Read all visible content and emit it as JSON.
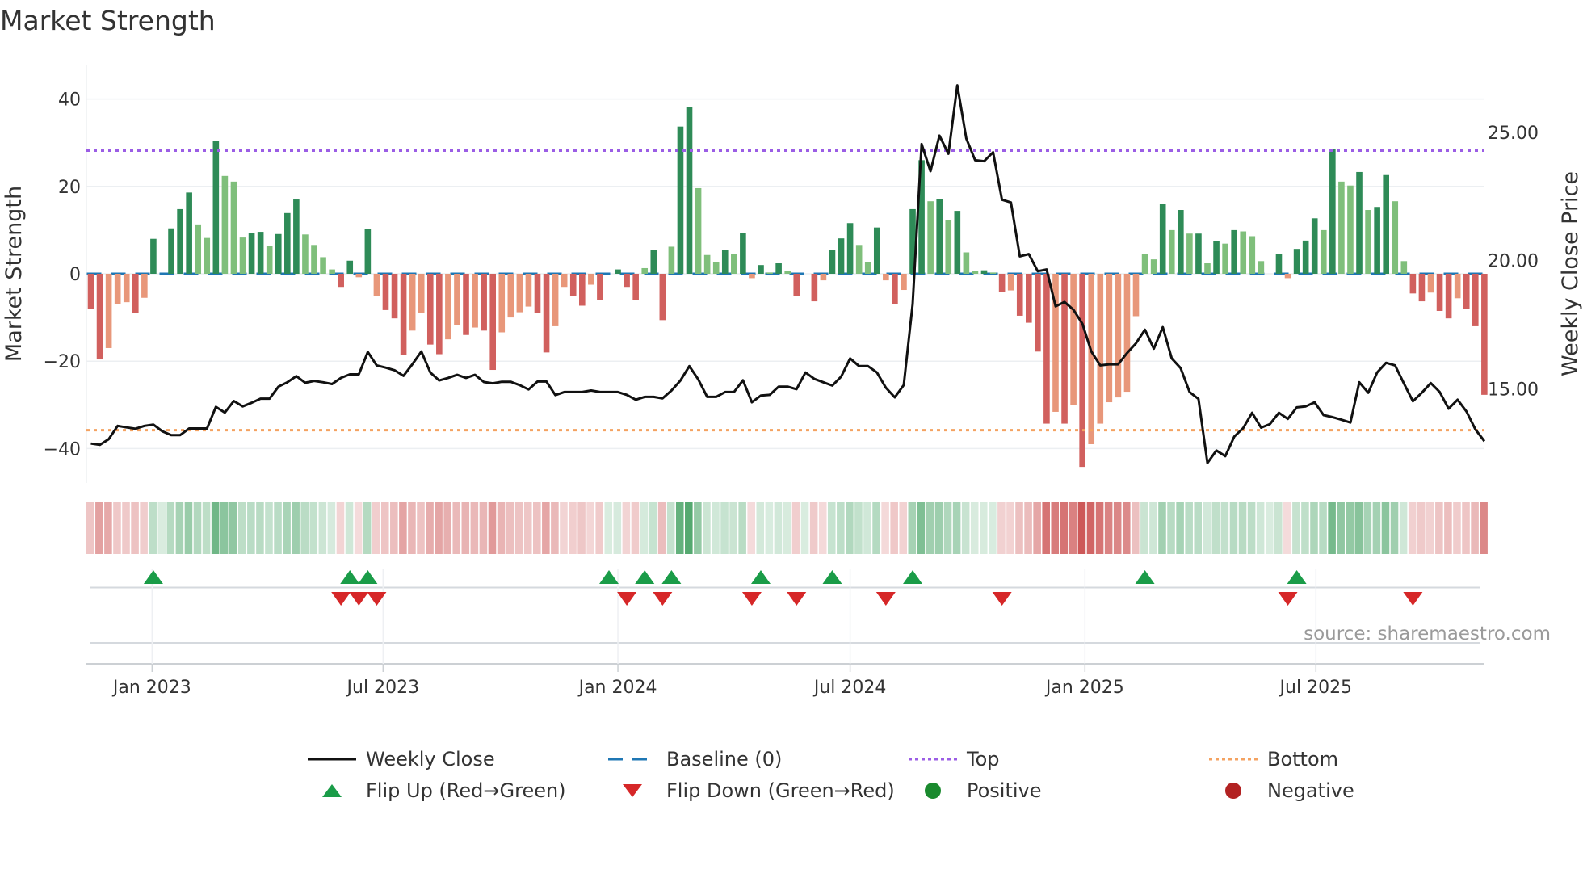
{
  "title": "Market Strength",
  "source": "source: sharemaestro.com",
  "colors": {
    "pos_strong": "#2e8b57",
    "pos_weak": "#7fbf7b",
    "neg_strong": "#d1605e",
    "neg_weak": "#e8977a",
    "line": "#111111",
    "baseline": "#1f77b4",
    "top": "#9b5de5",
    "bottom": "#f4a261",
    "flip_up": "#1a9c48",
    "flip_down": "#d62728",
    "positive": "#1a8a2e",
    "negative": "#b22222"
  },
  "legend": {
    "weekly_close": "Weekly Close",
    "baseline": "Baseline (0)",
    "top": "Top",
    "bottom": "Bottom",
    "flip_up": "Flip Up (Red→Green)",
    "flip_down": "Flip Down (Green→Red)",
    "positive": "Positive",
    "negative": "Negative"
  },
  "chart_data": {
    "type": "bar",
    "title": "Market Strength",
    "ylabel": "Market Strength",
    "y2label": "Weekly Close Price",
    "ylim": [
      -48,
      48
    ],
    "y2lim": [
      11.8,
      27.3
    ],
    "yticks": [
      "40",
      "20",
      "0",
      "−20",
      "−40"
    ],
    "ytick_values": [
      40,
      20,
      0,
      -20,
      -40
    ],
    "y2ticks": [
      "25.00",
      "20.00",
      "15.00"
    ],
    "y2tick_values": [
      25,
      20,
      15
    ],
    "xticks": [
      {
        "label": "Jan 2023",
        "date": "2023-01-01"
      },
      {
        "label": "Jul 2023",
        "date": "2023-07-01"
      },
      {
        "label": "Jan 2024",
        "date": "2024-01-01"
      },
      {
        "label": "Jul 2024",
        "date": "2024-07-01"
      },
      {
        "label": "Jan 2025",
        "date": "2025-01-01"
      },
      {
        "label": "Jul 2025",
        "date": "2025-07-01"
      }
    ],
    "first_week": "2022-11-14",
    "top_level": 28.2,
    "bottom_level": -35.8,
    "strength": [
      -8,
      -19.6,
      -17,
      -7,
      -6.5,
      -9,
      -5.5,
      8,
      0,
      10.4,
      14.8,
      18.6,
      11.3,
      8.2,
      30.4,
      22.4,
      21.1,
      8.3,
      9.3,
      9.6,
      6.4,
      9.1,
      13.9,
      17,
      9,
      6.6,
      3.8,
      1,
      -3,
      3,
      -0.8,
      10.3,
      -5,
      -8.3,
      -10.2,
      -18.6,
      -13,
      -8.9,
      -16.2,
      -18.4,
      -15,
      -11.8,
      -14,
      -12.3,
      -13,
      -22,
      -13.4,
      -10,
      -8.8,
      -7.5,
      -9,
      -18,
      -12,
      -3,
      -5,
      -7.3,
      -2.5,
      -6,
      0,
      1,
      -3,
      -6,
      1.3,
      5.5,
      -10.6,
      6.2,
      33.7,
      38.2,
      19.6,
      4.3,
      2.6,
      5.5,
      4.6,
      9.4,
      -1,
      2,
      0.3,
      2.4,
      0.7,
      -5,
      0,
      -6.3,
      -1.5,
      5.4,
      8.1,
      11.6,
      6.6,
      2.6,
      10.6,
      -1.5,
      -7,
      -3.7,
      14.8,
      26,
      16.6,
      17.1,
      12.3,
      14.4,
      4.9,
      0.6,
      0.8,
      0.3,
      -4.2,
      -3.8,
      -9.6,
      -11.2,
      -17.8,
      -34.3,
      -31.6,
      -34.3,
      -30,
      -44.2,
      -39,
      -34.3,
      -29.4,
      -28.3,
      -27,
      -9.7,
      4.6,
      3.3,
      16,
      10,
      14.6,
      9.2,
      9.2,
      2.4,
      7.4,
      6.9,
      10,
      9.7,
      8.6,
      2.9,
      0,
      4.6,
      -1,
      5.7,
      7.6,
      12.7,
      10,
      28.5,
      21.1,
      20.2,
      23.3,
      14.6,
      15.3,
      22.6,
      16.6,
      2.9,
      -4.5,
      -6.3,
      -4.3,
      -8.5,
      -10.2,
      -5.6,
      -8,
      -12,
      -27.7
    ],
    "weekly_close": [
      12.86,
      12.81,
      13.03,
      13.55,
      13.49,
      13.44,
      13.55,
      13.6,
      13.34,
      13.19,
      13.19,
      13.45,
      13.45,
      13.45,
      14.29,
      14.07,
      14.52,
      14.31,
      14.45,
      14.61,
      14.61,
      15.08,
      15.25,
      15.49,
      15.23,
      15.3,
      15.25,
      15.18,
      15.42,
      15.56,
      15.56,
      16.43,
      15.91,
      15.82,
      15.72,
      15.5,
      15.96,
      16.45,
      15.63,
      15.32,
      15.42,
      15.54,
      15.42,
      15.54,
      15.26,
      15.21,
      15.27,
      15.27,
      15.14,
      14.97,
      15.28,
      15.28,
      14.75,
      14.87,
      14.87,
      14.87,
      14.93,
      14.87,
      14.87,
      14.87,
      14.76,
      14.57,
      14.68,
      14.68,
      14.62,
      14.93,
      15.32,
      15.88,
      15.36,
      14.68,
      14.68,
      14.87,
      14.87,
      15.33,
      14.47,
      14.73,
      14.76,
      15.08,
      15.08,
      14.98,
      15.63,
      15.38,
      15.25,
      15.12,
      15.47,
      16.18,
      15.88,
      15.88,
      15.63,
      15.04,
      14.66,
      15.14,
      18.3,
      24.54,
      23.48,
      24.87,
      24.16,
      26.83,
      24.76,
      23.91,
      23.87,
      24.22,
      22.37,
      22.26,
      20.16,
      20.25,
      19.58,
      19.65,
      18.21,
      18.38,
      18.08,
      17.53,
      16.45,
      15.91,
      15.95,
      15.95,
      16.39,
      16.77,
      17.3,
      16.56,
      17.4,
      16.18,
      15.8,
      14.87,
      14.6,
      12.1,
      12.59,
      12.37,
      13.13,
      13.46,
      14.06,
      13.48,
      13.62,
      14.06,
      13.82,
      14.27,
      14.31,
      14.47,
      13.97,
      13.89,
      13.79,
      13.68,
      15.25,
      14.84,
      15.63,
      16.01,
      15.91,
      15.2,
      14.51,
      14.84,
      15.22,
      14.87,
      14.22,
      14.57,
      14.11,
      13.41,
      12.95
    ],
    "flip_up_weeks": [
      7,
      29,
      31,
      58,
      62,
      65,
      75,
      83,
      92,
      118,
      135
    ],
    "flip_down_weeks": [
      28,
      30,
      32,
      60,
      64,
      74,
      79,
      89,
      102,
      134,
      148
    ],
    "legend_position": "bottom"
  }
}
